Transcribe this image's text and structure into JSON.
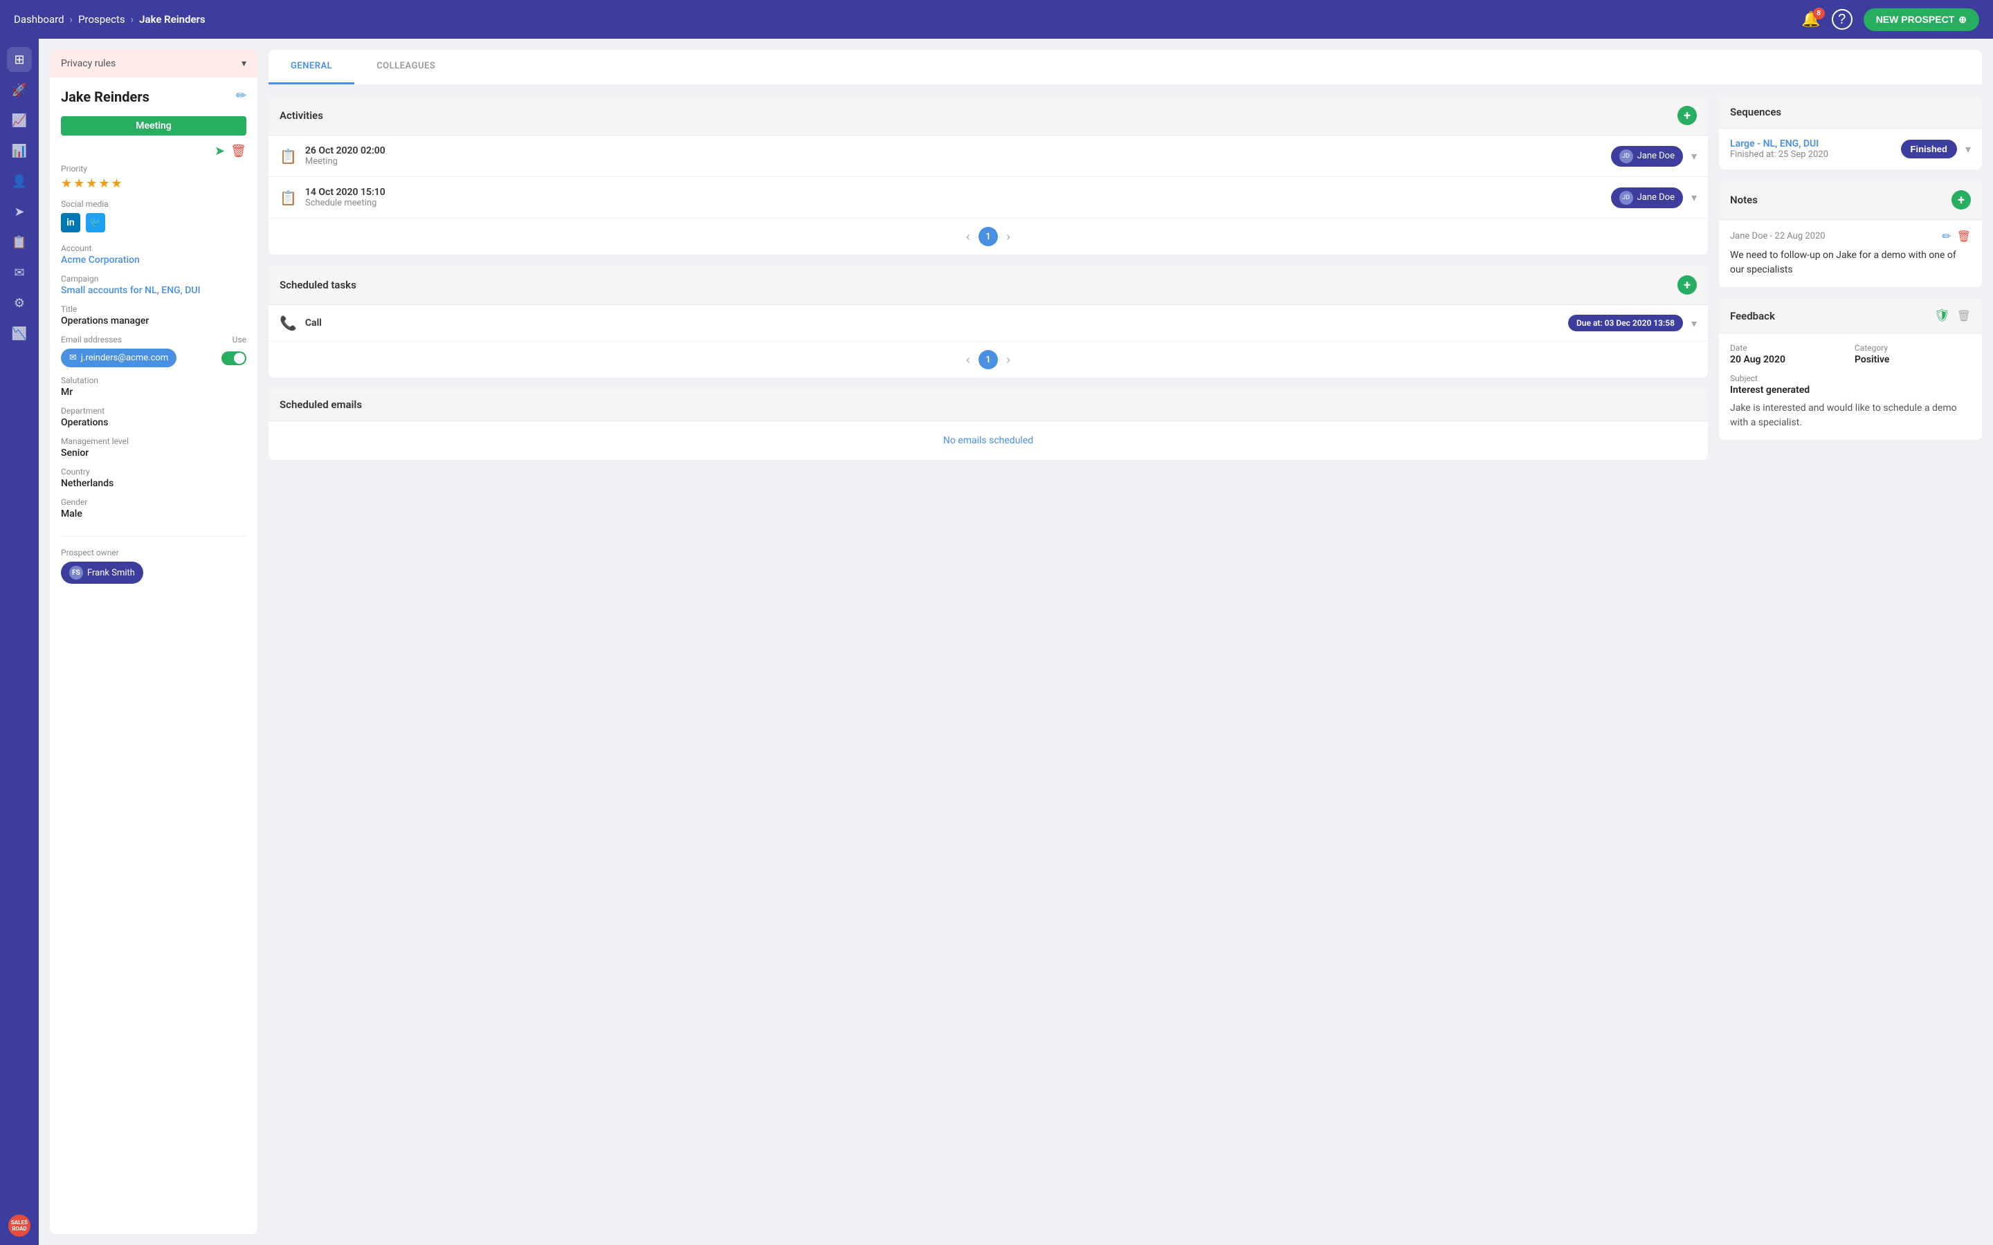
{
  "topnav": {
    "breadcrumb_home": "Dashboard",
    "breadcrumb_prospects": "Prospects",
    "breadcrumb_current": "Jake Reinders",
    "notification_count": "8",
    "new_prospect_label": "NEW PROSPECT"
  },
  "sidebar_icons": {
    "items": [
      {
        "name": "grid-icon",
        "symbol": "⊞"
      },
      {
        "name": "rocket-icon",
        "symbol": "🚀"
      },
      {
        "name": "trending-icon",
        "symbol": "📈"
      },
      {
        "name": "chart-icon",
        "symbol": "📊"
      },
      {
        "name": "users-icon",
        "symbol": "👤"
      },
      {
        "name": "send-icon",
        "symbol": "➤"
      },
      {
        "name": "tasks-icon",
        "symbol": "📋"
      },
      {
        "name": "email-icon",
        "symbol": "✉"
      },
      {
        "name": "settings-icon",
        "symbol": "⚙"
      },
      {
        "name": "reports-icon",
        "symbol": "📉"
      }
    ],
    "salesroad_label": "SALES ROAD"
  },
  "left_panel": {
    "privacy_rules_label": "Privacy rules",
    "prospect_name": "Jake Reinders",
    "meeting_badge": "Meeting",
    "priority_label": "Priority",
    "priority_stars": "★★★★★",
    "social_media_label": "Social media",
    "account_label": "Account",
    "account_value": "Acme Corporation",
    "campaign_label": "Campaign",
    "campaign_value": "Small accounts for NL, ENG, DUI",
    "title_label": "Title",
    "title_value": "Operations manager",
    "email_label": "Email addresses",
    "email_use_label": "Use",
    "email_value": "j.reinders@acme.com",
    "salutation_label": "Salutation",
    "salutation_value": "Mr",
    "department_label": "Department",
    "department_value": "Operations",
    "management_level_label": "Management level",
    "management_level_value": "Senior",
    "country_label": "Country",
    "country_value": "Netherlands",
    "gender_label": "Gender",
    "gender_value": "Male",
    "prospect_owner_label": "Prospect owner",
    "prospect_owner_name": "Frank Smith"
  },
  "tabs": {
    "general": "GENERAL",
    "colleagues": "COLLEAGUES"
  },
  "activities": {
    "title": "Activities",
    "items": [
      {
        "date": "26 Oct 2020 02:00",
        "type": "Meeting",
        "assignee": "Jane Doe"
      },
      {
        "date": "14 Oct 2020 15:10",
        "type": "Schedule meeting",
        "assignee": "Jane Doe"
      }
    ],
    "page": "1"
  },
  "scheduled_tasks": {
    "title": "Scheduled tasks",
    "items": [
      {
        "type": "Call",
        "due": "Due at: 03 Dec 2020 13:58"
      }
    ],
    "page": "1"
  },
  "scheduled_emails": {
    "title": "Scheduled emails",
    "empty_label": "No emails scheduled"
  },
  "sequences": {
    "title": "Sequences",
    "items": [
      {
        "name": "Large - NL, ENG, DUI",
        "finished_at": "Finished at: 25 Sep 2020",
        "status": "Finished"
      }
    ]
  },
  "notes": {
    "title": "Notes",
    "items": [
      {
        "author": "Jane Doe - 22 Aug 2020",
        "text": "We need to follow-up on Jake for a demo with one of our specialists"
      }
    ]
  },
  "feedback": {
    "title": "Feedback",
    "date_label": "Date",
    "date_value": "20 Aug 2020",
    "category_label": "Category",
    "category_value": "Positive",
    "subject_label": "Subject",
    "subject_value": "Interest generated",
    "body": "Jake is interested and would like to schedule a demo with a specialist."
  }
}
